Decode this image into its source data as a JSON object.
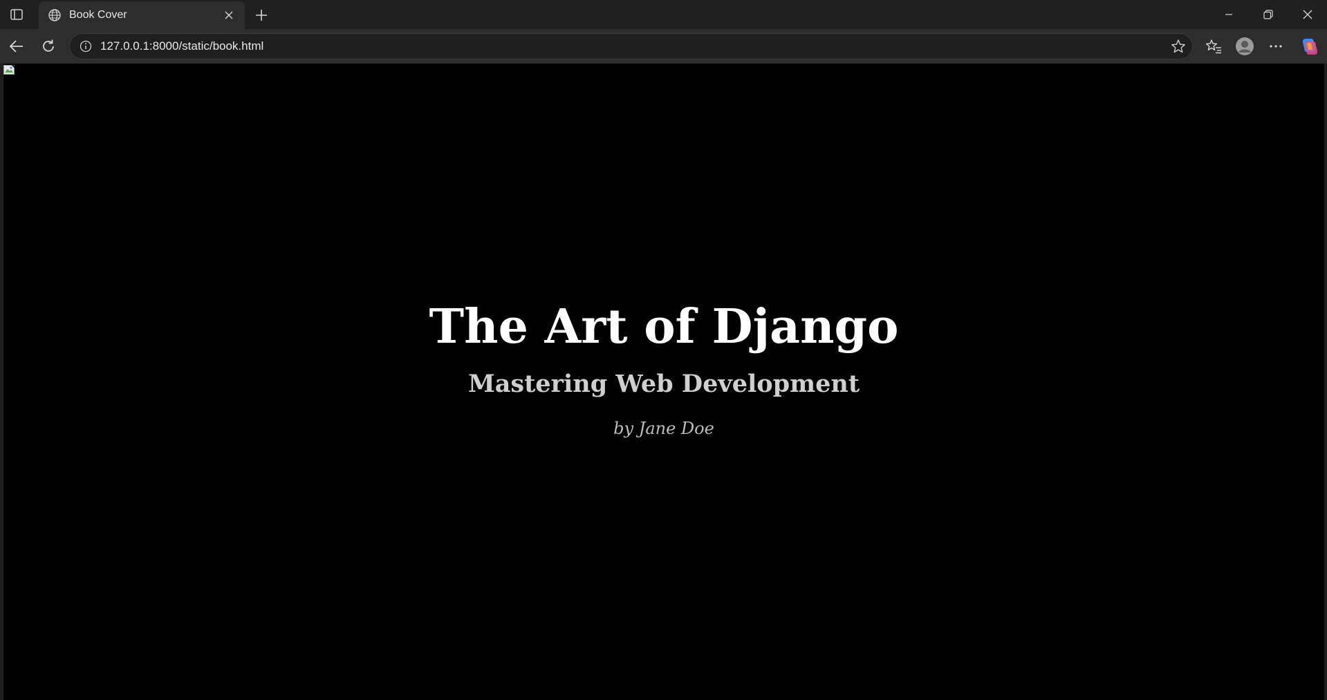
{
  "browser": {
    "tab": {
      "title": "Book Cover"
    },
    "address": {
      "url": "127.0.0.1:8000/static/book.html"
    }
  },
  "page": {
    "title": "The Art of Django",
    "subtitle": "Mastering Web Development",
    "author": "by Jane Doe",
    "background_color": "#000000"
  },
  "icons": {
    "sidebar_toggle": "sidebar-toggle-icon",
    "tab_favicon": "globe-icon",
    "tab_close": "close-icon",
    "new_tab": "plus-icon",
    "back": "back-arrow-icon",
    "refresh": "refresh-icon",
    "site_info": "info-icon",
    "favorite": "star-icon",
    "favorites": "favorites-icon",
    "profile": "profile-icon",
    "more": "more-icon",
    "copilot": "copilot-icon",
    "broken_image": "broken-image-icon"
  }
}
